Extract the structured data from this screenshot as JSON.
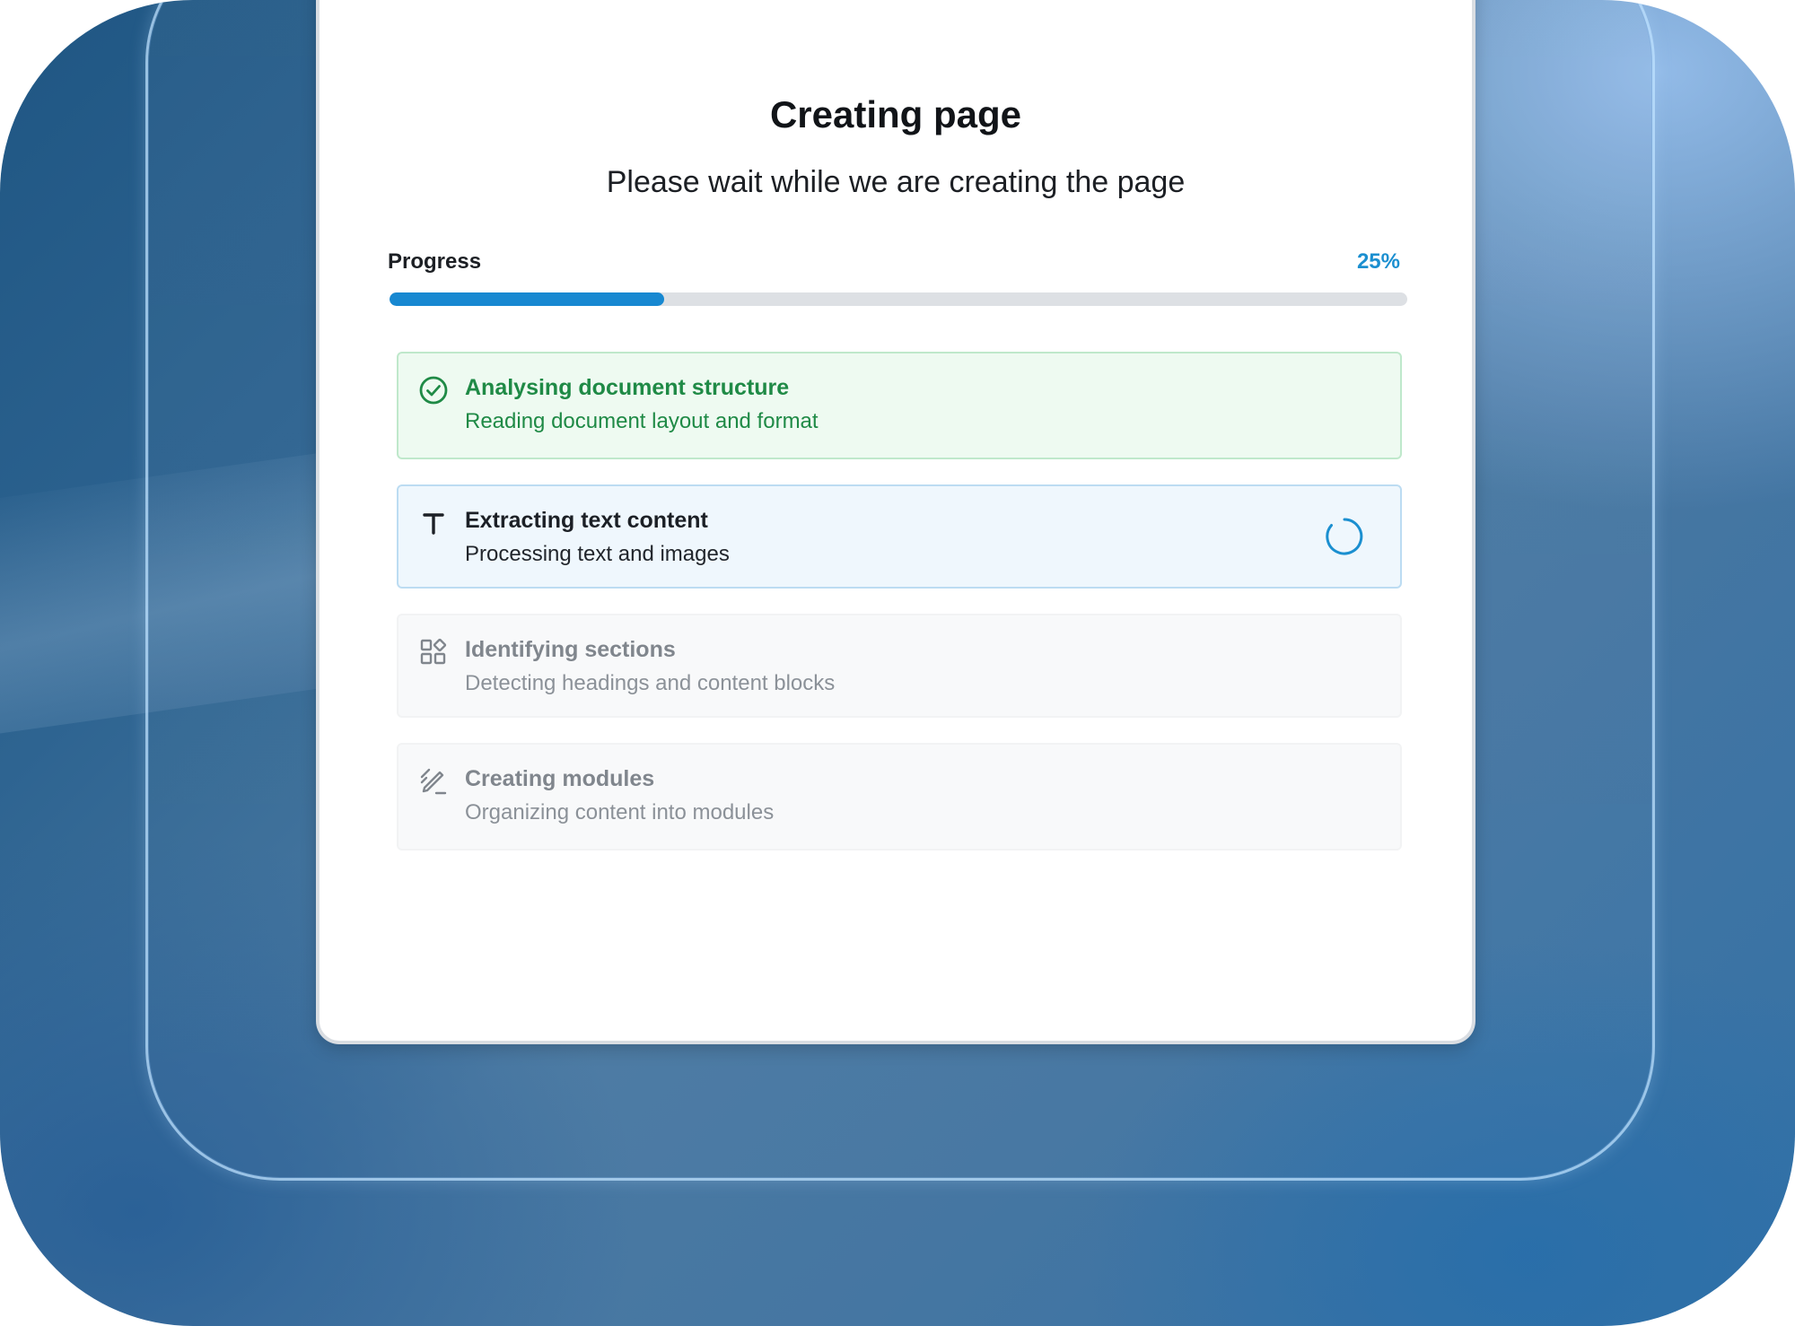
{
  "dialog": {
    "title": "Creating page",
    "subtitle": "Please wait while we are creating the page"
  },
  "progress": {
    "label": "Progress",
    "percent_text": "25%",
    "fraction": 0.27,
    "fill_color": "#1788d1"
  },
  "steps": [
    {
      "status": "done",
      "icon": "check-circle-icon",
      "title": "Analysing document structure",
      "description": "Reading document layout and format"
    },
    {
      "status": "active",
      "icon": "text-icon",
      "title": "Extracting text content",
      "description": "Processing text and images",
      "indicator": "spinner-icon"
    },
    {
      "status": "pending",
      "icon": "shapes-icon",
      "title": "Identifying sections",
      "description": "Detecting headings and content blocks"
    },
    {
      "status": "pending",
      "icon": "pencil-draw-icon",
      "title": "Creating modules",
      "description": "Organizing content into modules"
    }
  ],
  "colors": {
    "done": "#1f8a46",
    "active_accent": "#1b8fd0",
    "pending": "#80868d"
  }
}
